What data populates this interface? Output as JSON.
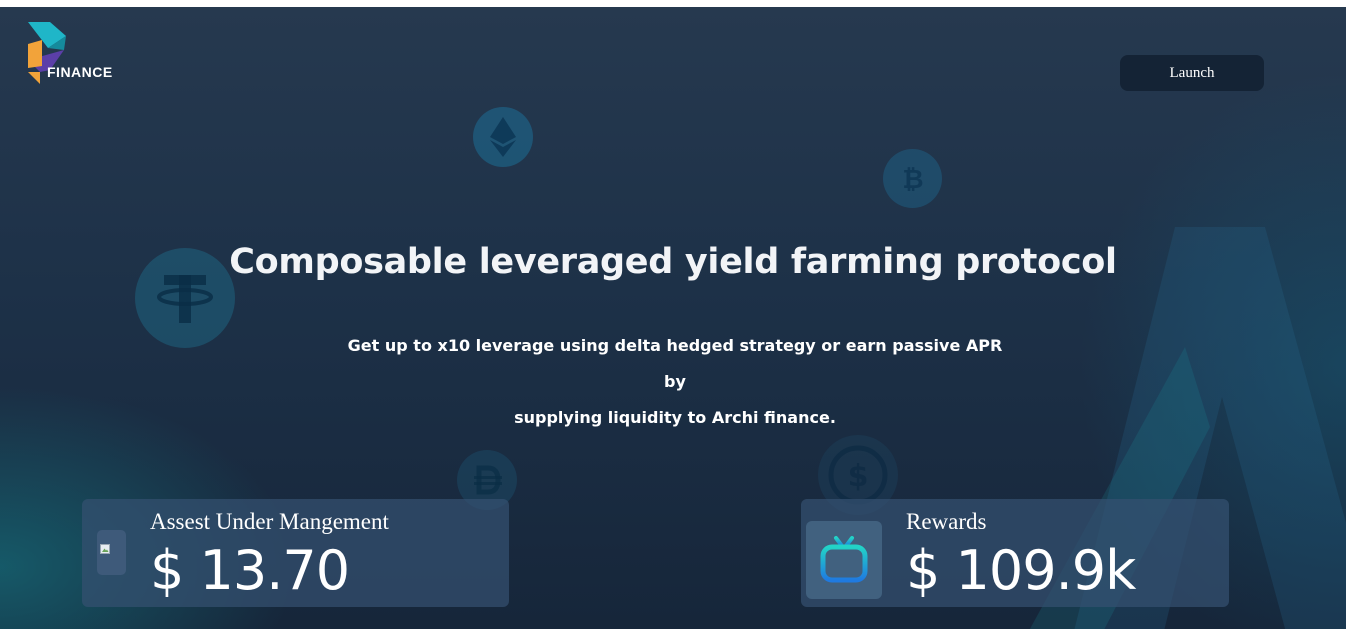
{
  "brand": {
    "name": "FINANCE"
  },
  "header": {
    "launch_label": "Launch"
  },
  "hero": {
    "title": "Composable leveraged yield farming protocol",
    "subtitle_line1": "Get up to x10 leverage using delta hedged strategy or earn passive APR by",
    "subtitle_line2": "supplying liquidity to Archi finance."
  },
  "stats": {
    "aum": {
      "label": "Assest Under Mangement",
      "value": "$ 13.70"
    },
    "rewards": {
      "label": "Rewards",
      "value": "$ 109.9k"
    }
  },
  "background_icons": [
    "ethereum-icon",
    "bitcoin-icon",
    "tether-icon",
    "dai-icon",
    "usdc-icon"
  ],
  "colors": {
    "accent_teal": "#1fb6c8",
    "accent_orange": "#f2a33a",
    "accent_purple": "#5b3fa8",
    "button_bg": "#142335"
  }
}
